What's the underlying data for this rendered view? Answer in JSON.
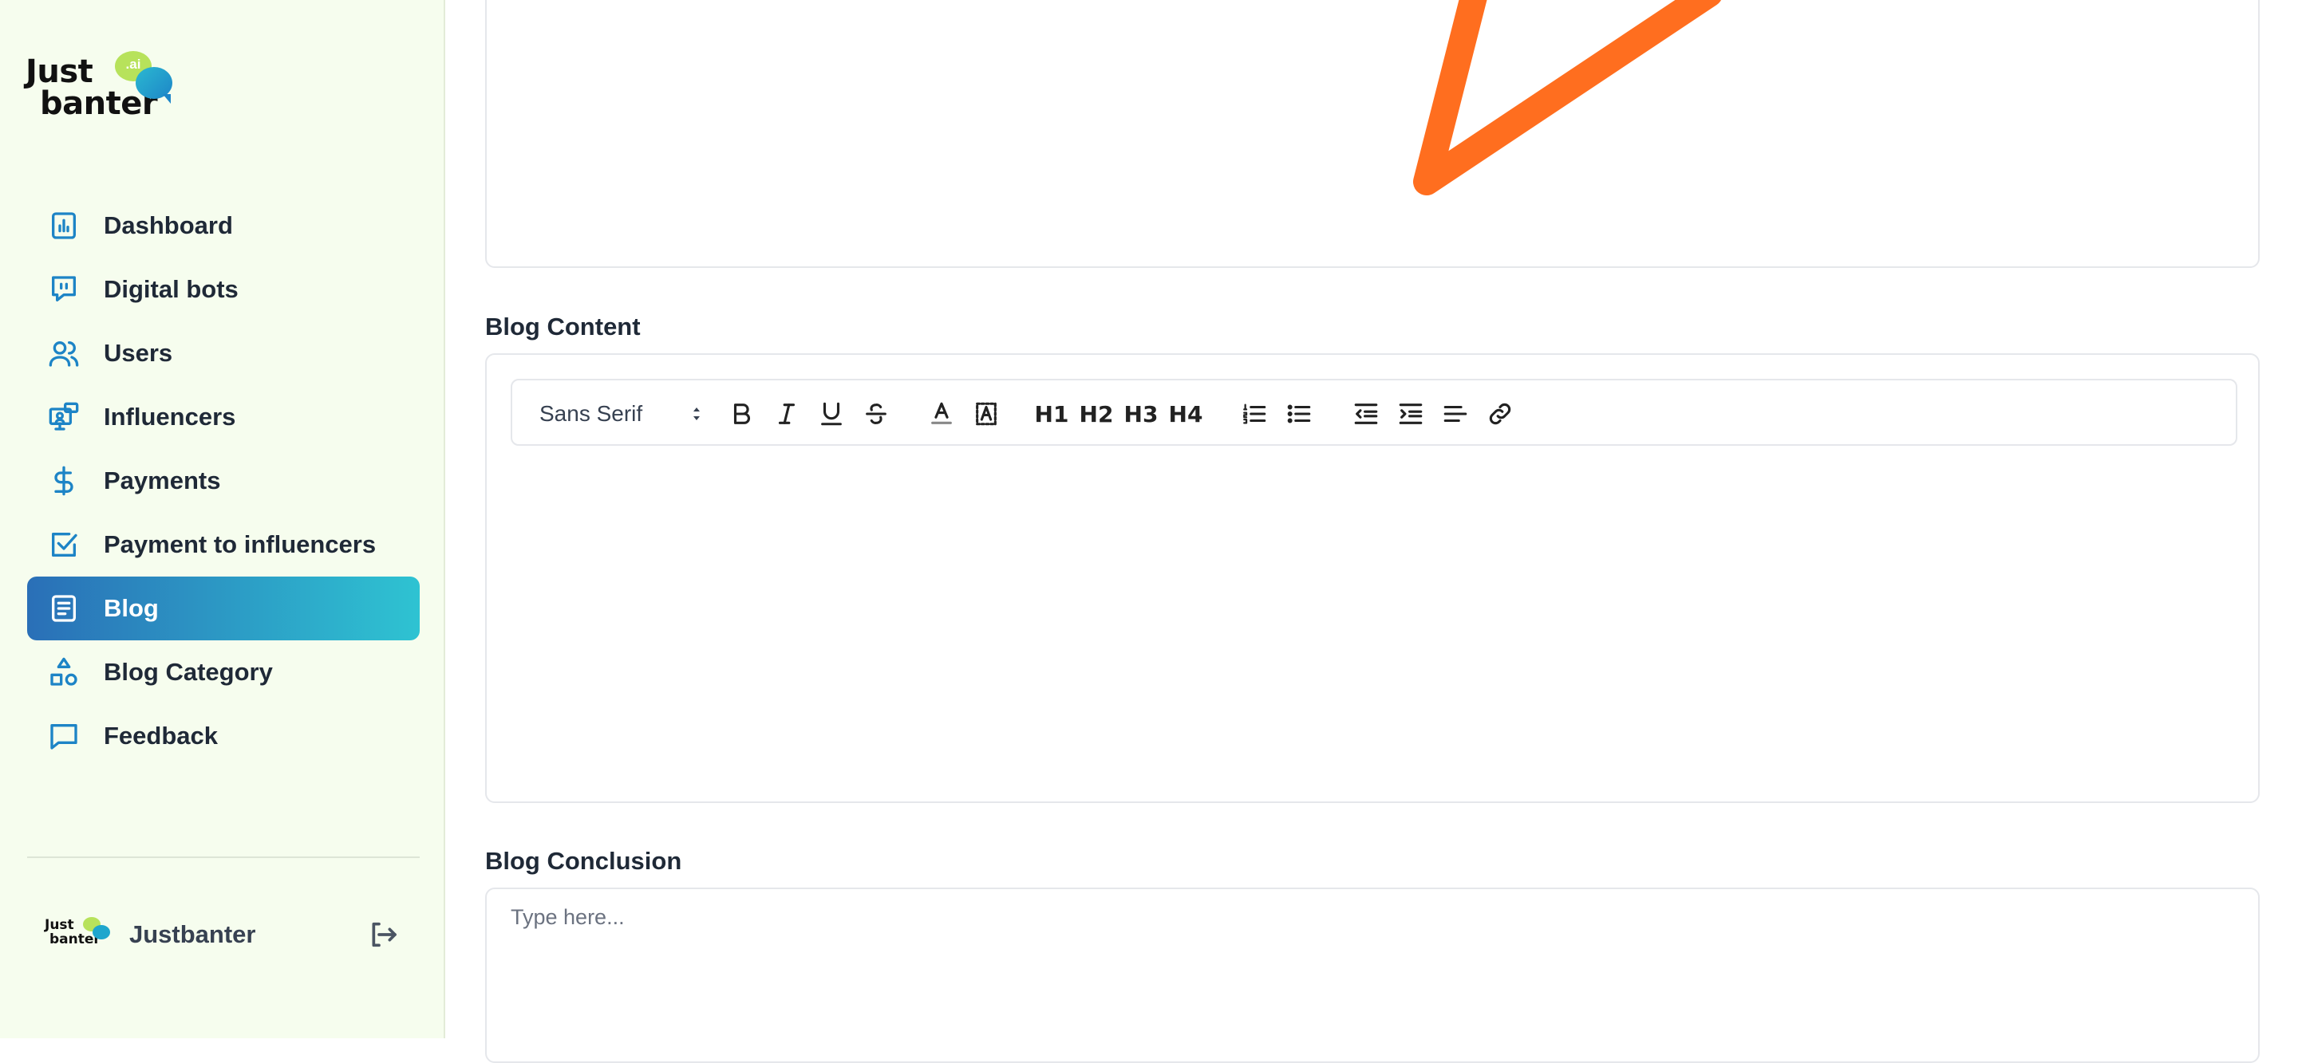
{
  "brand": {
    "logo_line1": "Just",
    "logo_line2": "banter",
    "logo_badge": ".ai"
  },
  "sidebar": {
    "items": [
      {
        "label": "Dashboard",
        "icon": "chart-icon",
        "active": false
      },
      {
        "label": "Digital bots",
        "icon": "chat-bot-icon",
        "active": false
      },
      {
        "label": "Users",
        "icon": "users-icon",
        "active": false
      },
      {
        "label": "Influencers",
        "icon": "influencer-monitor-icon",
        "active": false
      },
      {
        "label": "Payments",
        "icon": "dollar-icon",
        "active": false
      },
      {
        "label": "Payment to influencers",
        "icon": "checkbox-icon",
        "active": false
      },
      {
        "label": "Blog",
        "icon": "document-icon",
        "active": true
      },
      {
        "label": "Blog Category",
        "icon": "shapes-icon",
        "active": false
      },
      {
        "label": "Feedback",
        "icon": "message-icon",
        "active": false
      }
    ],
    "user": {
      "name": "Justbanter",
      "mini_logo_line1": "Just",
      "mini_logo_line2": "banter"
    }
  },
  "main": {
    "blog_content_label": "Blog Content",
    "editor": {
      "font": "Sans Serif",
      "headings": [
        "H1",
        "H2",
        "H3",
        "H4"
      ]
    },
    "blog_conclusion_label": "Blog Conclusion",
    "conclusion_placeholder": "Type here..."
  },
  "colors": {
    "sidebar_bg": "#f6fdee",
    "active_gradient_start": "#2a6fb7",
    "active_gradient_end": "#2ec3d2",
    "icon_blue": "#1d84c6",
    "image_accent": "#ff6e1f"
  }
}
